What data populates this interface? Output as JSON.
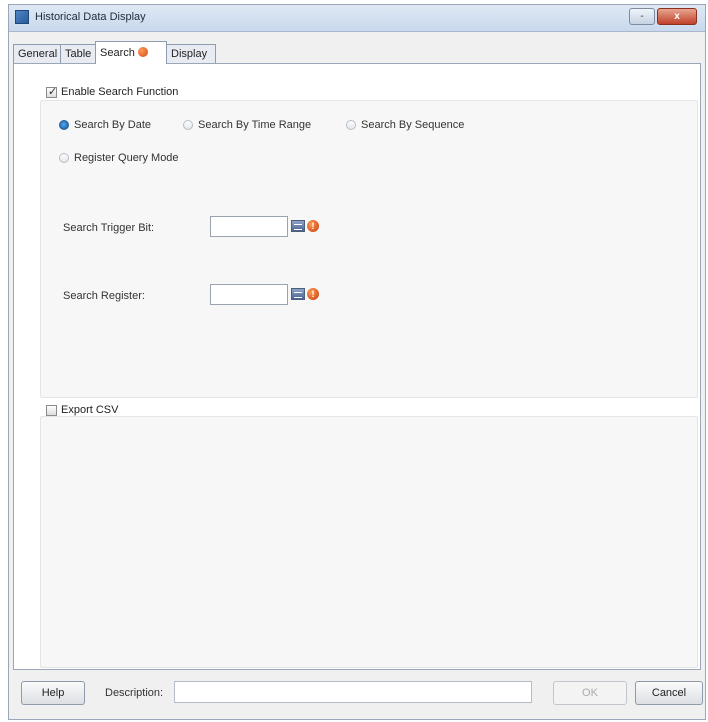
{
  "window": {
    "title": "Historical Data Display",
    "restore_label": "−̅",
    "close_label": "x"
  },
  "tabs": [
    {
      "label": "General",
      "active": false
    },
    {
      "label": "Table",
      "active": false
    },
    {
      "label": "Search",
      "active": true,
      "has_warning": true
    },
    {
      "label": "Display",
      "active": false
    }
  ],
  "search": {
    "enable_label": "Enable Search Function",
    "enable_checked": true,
    "modes": [
      {
        "label": "Search By Date",
        "selected": true
      },
      {
        "label": "Search By Time Range",
        "selected": false
      },
      {
        "label": "Search By Sequence",
        "selected": false
      },
      {
        "label": "Register Query Mode",
        "selected": false
      }
    ],
    "trigger_bit_label": "Search Trigger Bit:",
    "trigger_bit_value": "",
    "register_label": "Search Register:",
    "register_value": ""
  },
  "export": {
    "label": "Export CSV",
    "checked": false
  },
  "footer": {
    "help_label": "Help",
    "description_label": "Description:",
    "description_value": "",
    "ok_label": "OK",
    "cancel_label": "Cancel"
  },
  "icons": {
    "warning_color": "#d24a10",
    "address_button": "address-picker-icon"
  }
}
